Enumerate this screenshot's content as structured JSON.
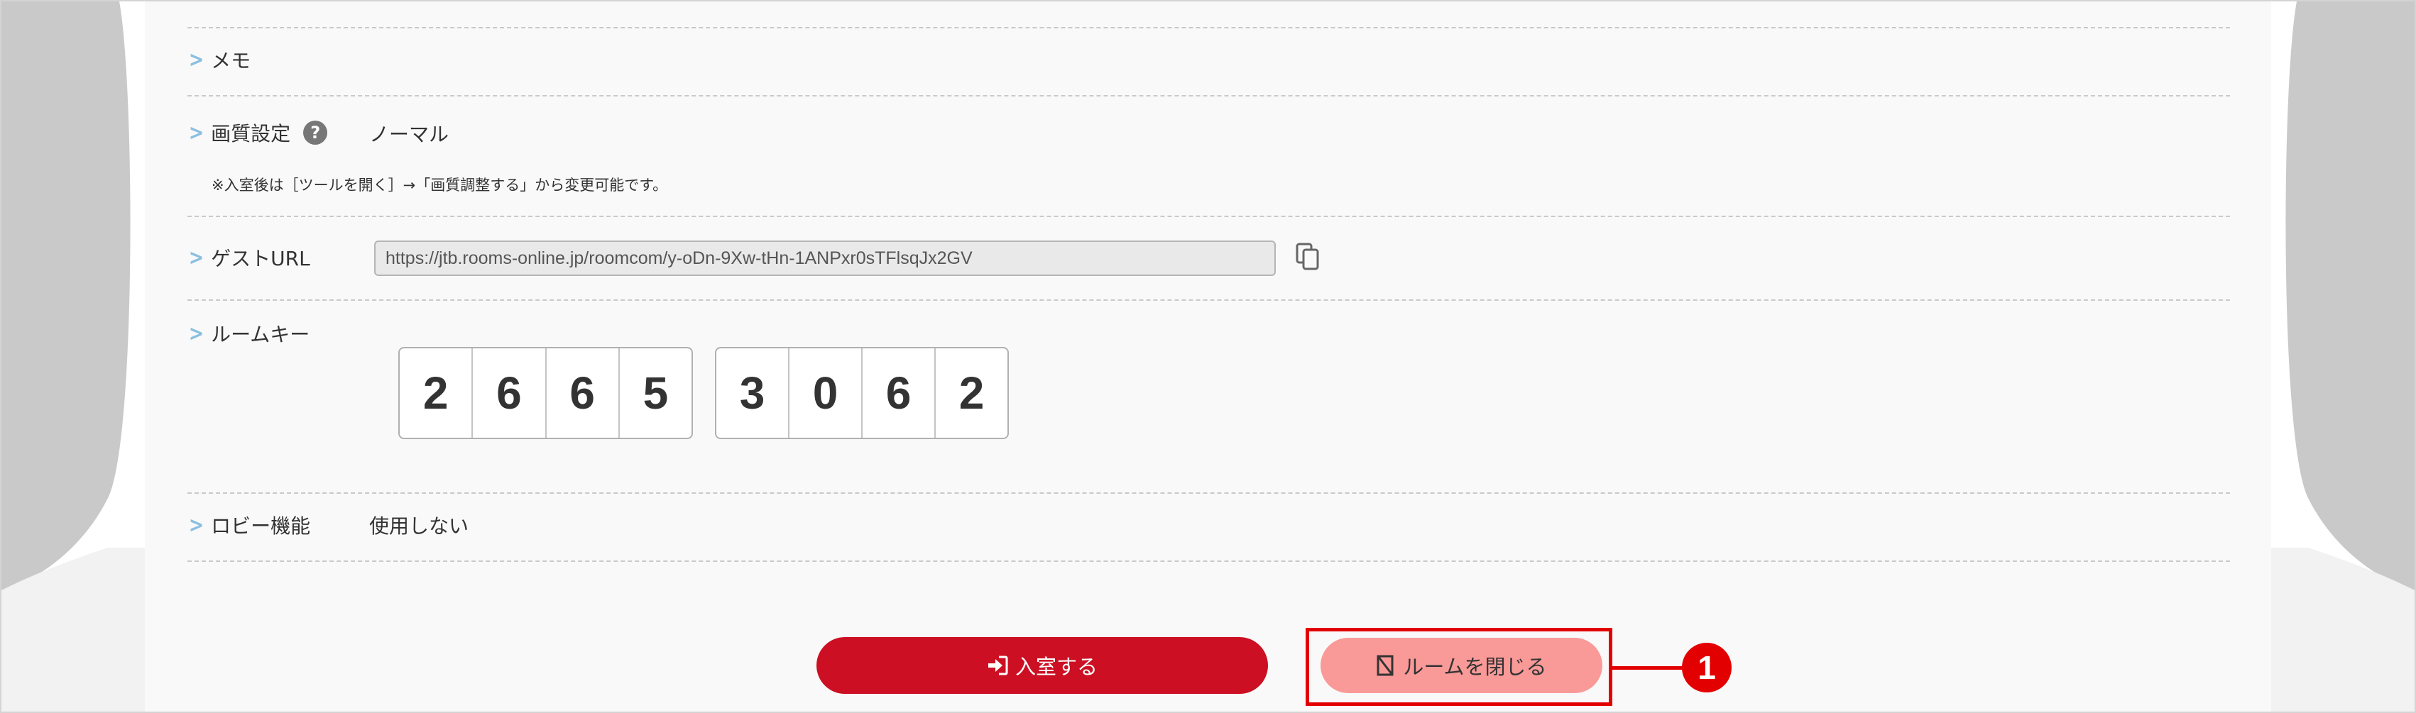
{
  "rows": {
    "memo": {
      "label": "メモ"
    },
    "quality": {
      "label": "画質設定",
      "help_icon": "question-circle-icon",
      "help_glyph": "?",
      "value": "ノーマル",
      "note": "※入室後は［ツールを開く］→「画質調整する」から変更可能です。"
    },
    "guest_url": {
      "label": "ゲストURL",
      "value": "https://jtb.rooms-online.jp/roomcom/y-oDn-9Xw-tHn-1ANPxr0sTFlsqJx2GV",
      "copy_icon": "copy-icon"
    },
    "room_key": {
      "label": "ルームキー",
      "group1": [
        "2",
        "6",
        "6",
        "5"
      ],
      "group2": [
        "3",
        "0",
        "6",
        "2"
      ]
    },
    "lobby": {
      "label": "ロビー機能",
      "value": "使用しない"
    }
  },
  "chevron_glyph": ">",
  "buttons": {
    "enter": {
      "label": "入室する",
      "icon": "sign-in-icon",
      "color": "#cc0f23"
    },
    "close": {
      "label": "ルームを閉じる",
      "icon": "close-room-icon",
      "color": "#f99a98"
    }
  },
  "annotation": {
    "number": "1",
    "color": "#e30000"
  }
}
